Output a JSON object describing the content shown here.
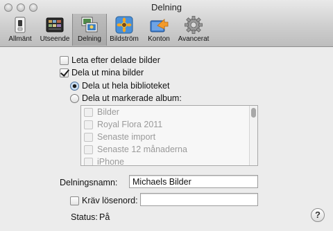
{
  "window": {
    "title": "Delning"
  },
  "toolbar": {
    "items": [
      {
        "label": "Allmänt",
        "icon": "switch-icon"
      },
      {
        "label": "Utseende",
        "icon": "appearance-icon"
      },
      {
        "label": "Delning",
        "icon": "sharing-icon",
        "selected": true
      },
      {
        "label": "Bildström",
        "icon": "photostream-icon"
      },
      {
        "label": "Konton",
        "icon": "accounts-icon"
      },
      {
        "label": "Avancerat",
        "icon": "gear-icon"
      }
    ]
  },
  "sharing": {
    "look_for_shared": {
      "label": "Leta efter delade bilder",
      "checked": false
    },
    "share_my_photos": {
      "label": "Dela ut mina bilder",
      "checked": true
    },
    "share_entire_library": {
      "label": "Dela ut hela biblioteket",
      "selected": true
    },
    "share_selected_albums": {
      "label": "Dela ut markerade album:",
      "selected": false
    },
    "albums": [
      "Bilder",
      "Royal Flora 2011",
      "Senaste import",
      "Senaste 12 månaderna",
      "iPhone"
    ],
    "share_name": {
      "label": "Delningsnamn:",
      "value": "Michaels Bilder"
    },
    "require_password": {
      "label": "Kräv lösenord:",
      "checked": false,
      "value": ""
    },
    "status": {
      "label": "Status:",
      "value": "På"
    }
  },
  "help": {
    "label": "?"
  }
}
